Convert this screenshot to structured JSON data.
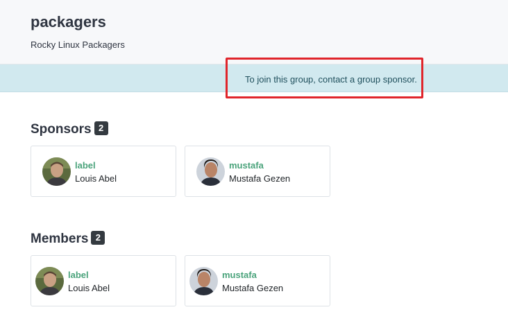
{
  "group": {
    "name": "packagers",
    "description": "Rocky Linux Packagers"
  },
  "alert": {
    "text": "To join this group, contact a group sponsor."
  },
  "sponsors": {
    "title": "Sponsors",
    "count": "2",
    "people": [
      {
        "username": "label",
        "full_name": "Louis Abel",
        "avatar": "user-avatar-photo"
      },
      {
        "username": "mustafa",
        "full_name": "Mustafa Gezen",
        "avatar": "user-avatar-photo"
      }
    ]
  },
  "members": {
    "title": "Members",
    "count": "2",
    "people": [
      {
        "username": "label",
        "full_name": "Louis Abel",
        "avatar": "user-avatar-photo"
      },
      {
        "username": "mustafa",
        "full_name": "Mustafa Gezen",
        "avatar": "user-avatar-photo"
      }
    ]
  },
  "colors": {
    "accent_link": "#4aa37b",
    "alert_background": "#d1e9ef",
    "highlight_border": "#e0252b",
    "badge_background": "#343a40"
  }
}
